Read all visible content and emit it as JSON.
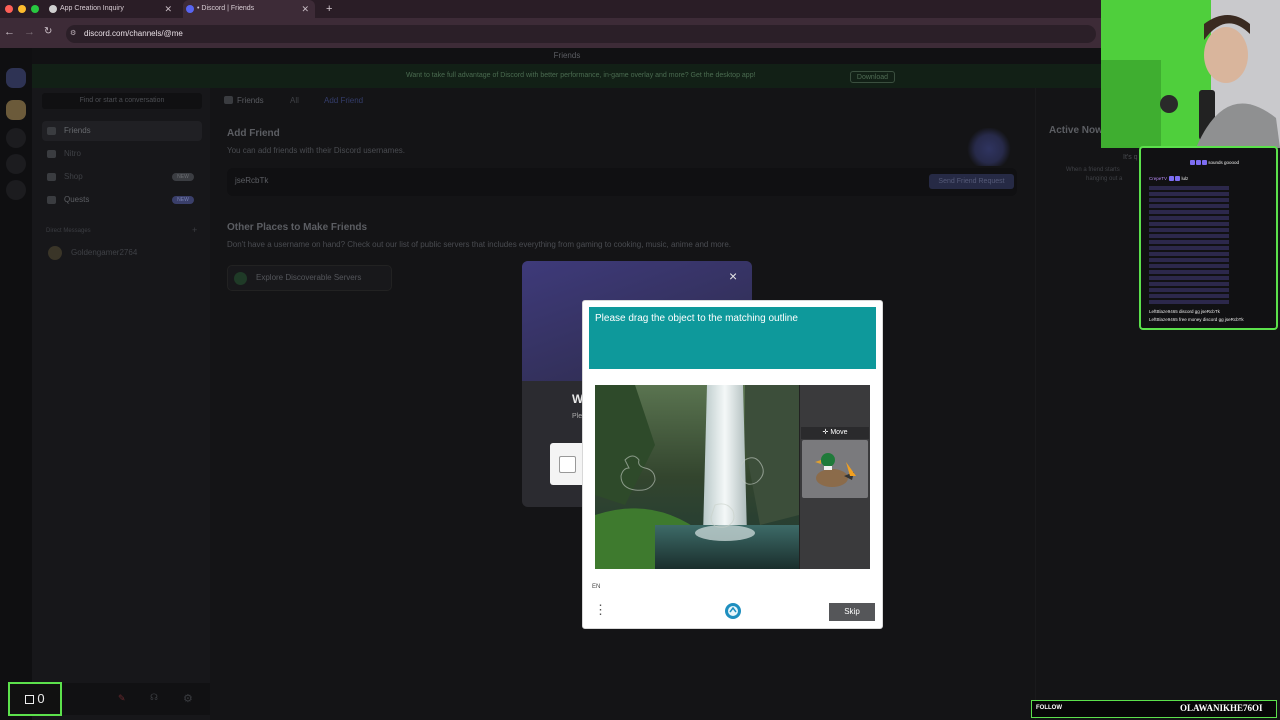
{
  "browser": {
    "tabs": [
      {
        "label": "App Creation Inquiry"
      },
      {
        "label": "• Discord | Friends"
      }
    ],
    "url": "discord.com/channels/@me",
    "new_tab": "+"
  },
  "discord": {
    "top_strip": "Friends",
    "banner_text": "Want to take full advantage of Discord with better performance, in-game overlay and more? Get the desktop app!",
    "banner_button": "Download",
    "search_placeholder": "Find or start a conversation",
    "sidebar": [
      {
        "label": "Friends"
      },
      {
        "label": "Nitro"
      },
      {
        "label": "Shop",
        "badge": "NEW"
      },
      {
        "label": "Quests",
        "badge": "NEW"
      }
    ],
    "dm_header": "Direct Messages",
    "dm_add": "+",
    "dm_user": "Goldengamer2764",
    "friends_tabs": {
      "friends": "Friends",
      "all": "All",
      "add": "Add Friend"
    },
    "add_friend": {
      "title": "Add Friend",
      "subtitle": "You can add friends with their Discord usernames.",
      "input_value": "jseRcbTk",
      "button": "Send Friend Request"
    },
    "other_places": {
      "title": "Other Places to Make Friends",
      "subtitle": "Don't have a username on hand? Check out our list of public servers that includes everything from gaming to cooking, music, anime and more.",
      "explore": "Explore Discoverable Servers"
    },
    "active_now": {
      "title": "Active Now",
      "line1": "It's q",
      "line2": "When a friend starts",
      "line3": "hanging out a"
    }
  },
  "modal": {
    "close": "×",
    "partial_w": "W",
    "partial_pl": "Ple"
  },
  "captcha": {
    "instruction": "Please drag the object to the matching outline",
    "move_tip": "Move",
    "language": "EN",
    "menu": "⋮",
    "skip": "Skip"
  },
  "stream": {
    "counter": "0",
    "follow_label": "FOLLOW",
    "follow_name": "OLAWANIKHE76OI",
    "chat": [
      {
        "user": "CrepeTV",
        "text": "sounds gooood"
      },
      {
        "user": "CrepeTV",
        "text": "lulz"
      },
      {
        "user": "LeftBlaze9465",
        "text": "discord gg jseRcbTk"
      },
      {
        "user": "LeftBlaze9465",
        "text": "free money discord gg jseRcbTk"
      }
    ]
  },
  "colors": {
    "captcha_teal": "#0e999b",
    "overlay_green": "#5ce14c",
    "skip_gray": "#555659"
  }
}
